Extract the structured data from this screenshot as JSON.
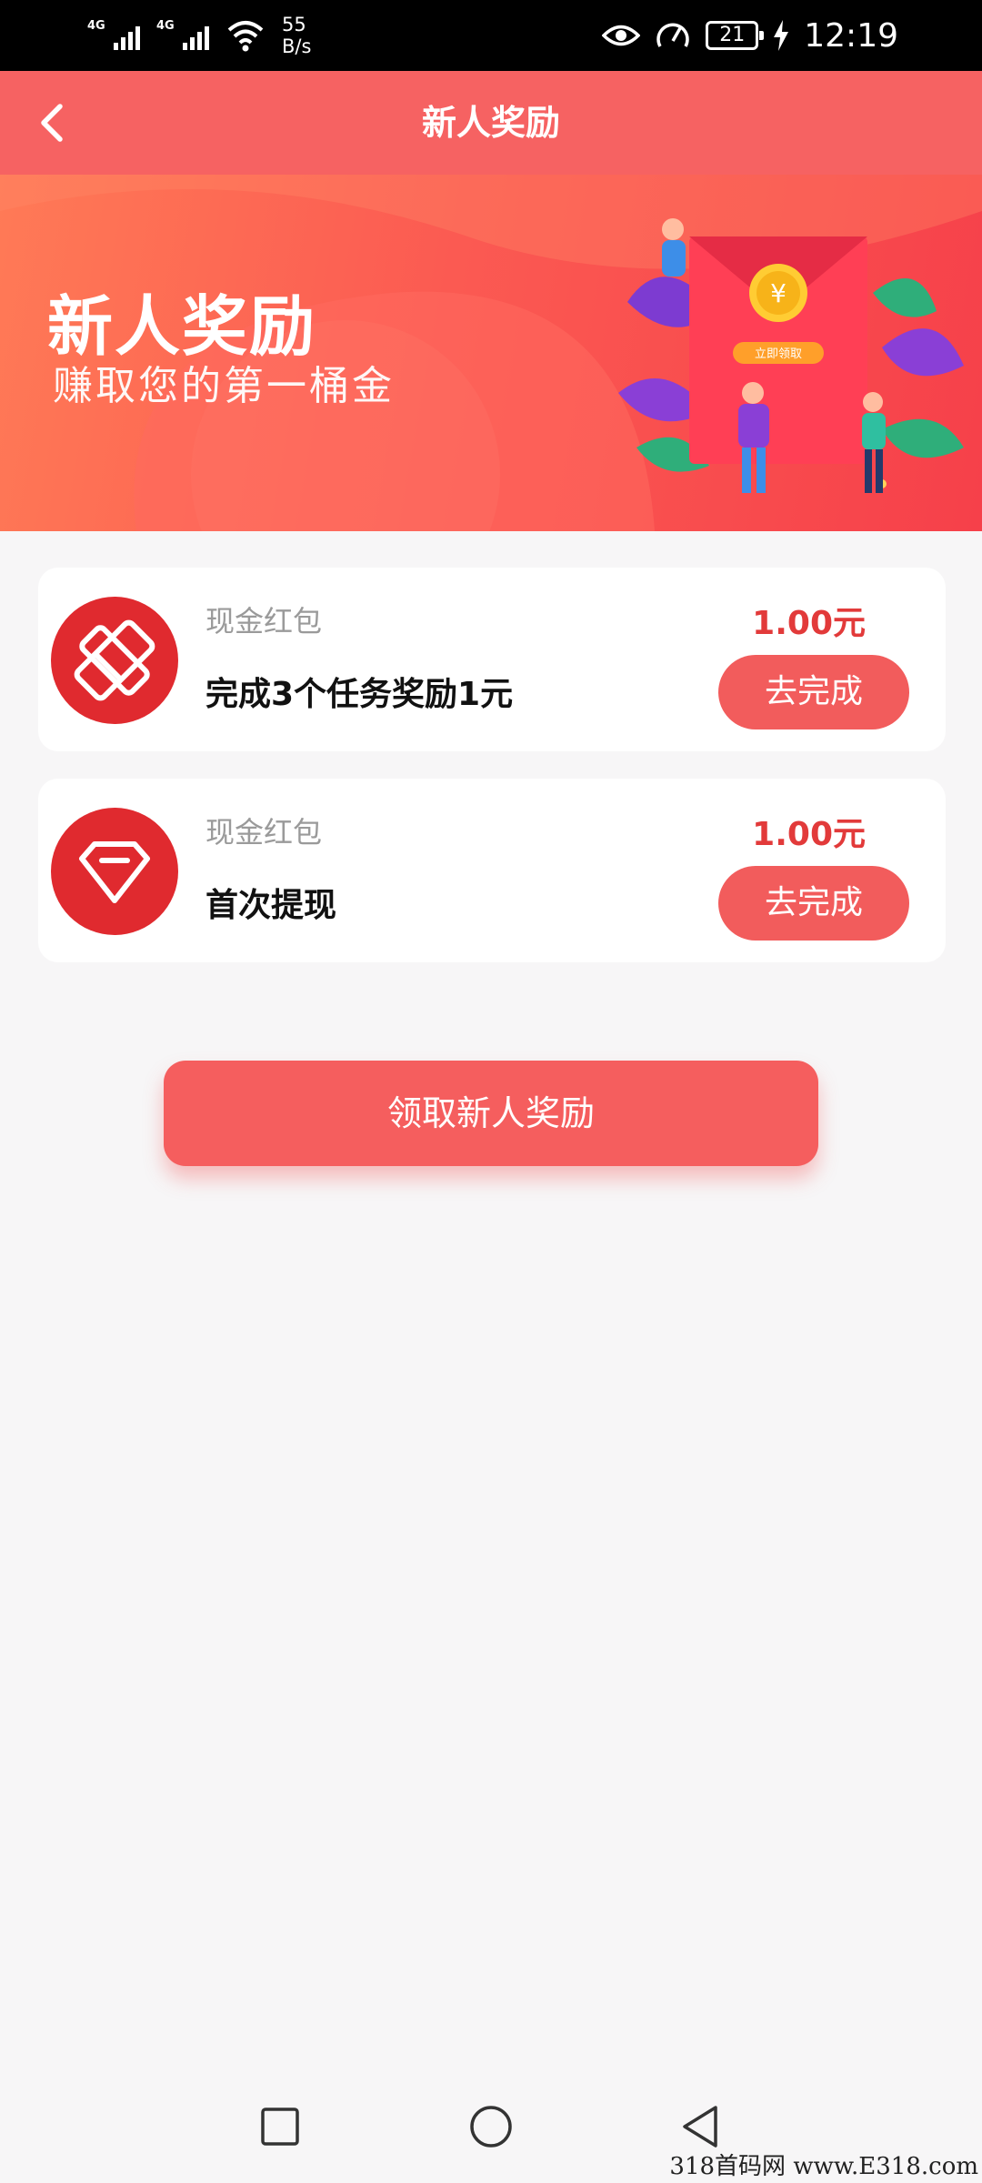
{
  "status_bar": {
    "network_1": "4G",
    "network_2": "4G",
    "speed_value": "55",
    "speed_unit": "B/s",
    "battery": "21",
    "time": "12:19",
    "icons": [
      "signal-icon",
      "signal-icon",
      "wifi-icon",
      "eye-icon",
      "speed-gauge-icon",
      "battery-icon",
      "charging-icon"
    ]
  },
  "header": {
    "title": "新人奖励",
    "back_icon": "chevron-left-icon"
  },
  "banner": {
    "title": "新人奖励",
    "subtitle": "赚取您的第一桶金",
    "envelope_text": "立即领取",
    "coin_symbol": "¥"
  },
  "rewards": [
    {
      "icon": "coupon-ticket-icon",
      "label": "现金红包",
      "title": "完成3个任务奖励1元",
      "amount": "1.00元",
      "action": "去完成"
    },
    {
      "icon": "diamond-icon",
      "label": "现金红包",
      "title": "首次提现",
      "amount": "1.00元",
      "action": "去完成"
    }
  ],
  "claim_button": "领取新人奖励",
  "nav": {
    "icons": [
      "recent-apps-icon",
      "home-icon",
      "back-icon"
    ]
  },
  "watermark": "318首码网 www.E318.com",
  "colors": {
    "primary": "#f66262",
    "amount": "#e23a3a",
    "background": "#f7f6f7"
  }
}
